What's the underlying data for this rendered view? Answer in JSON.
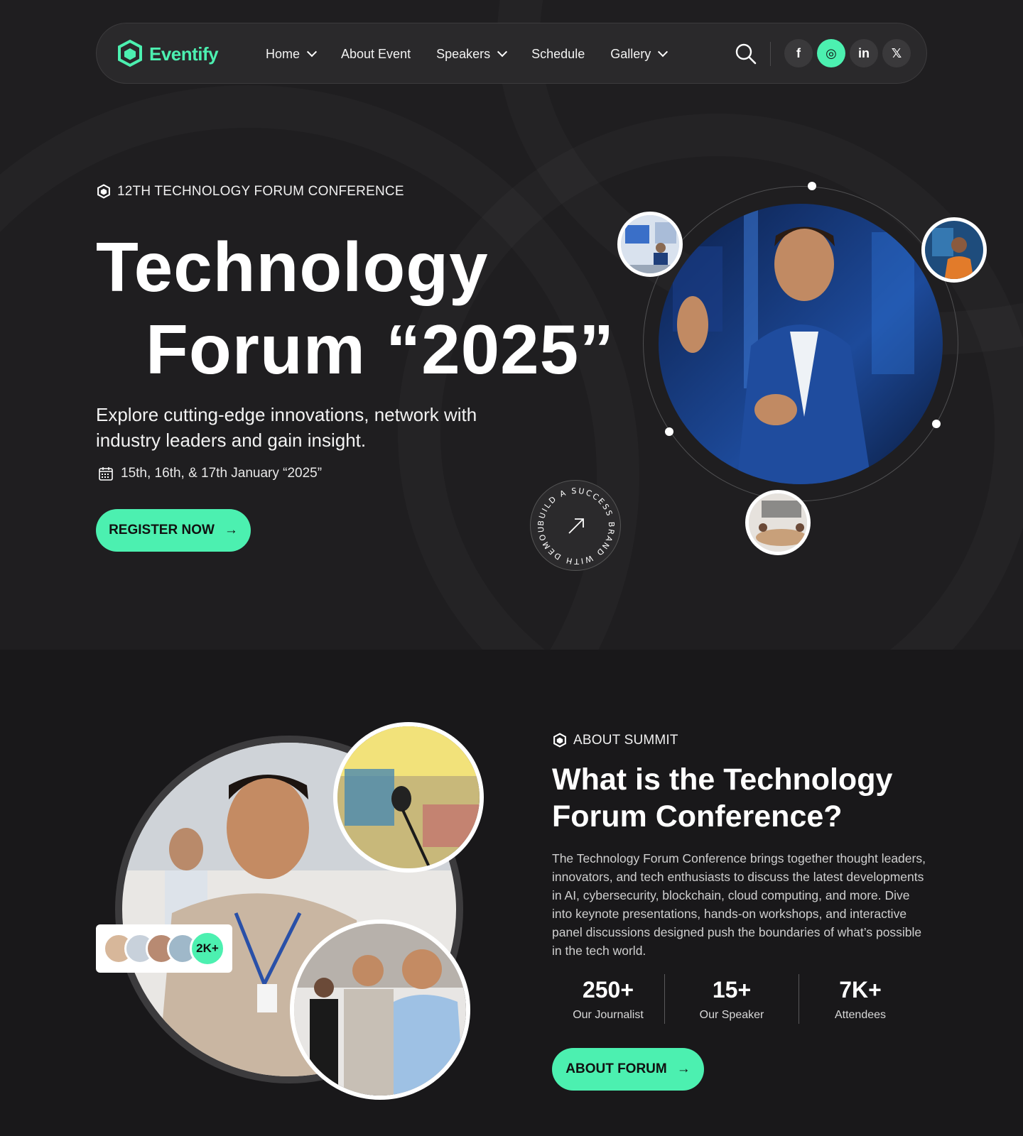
{
  "nav": {
    "brand": "Eventify",
    "items": [
      {
        "label": "Home",
        "dropdown": true
      },
      {
        "label": "About Event",
        "dropdown": false
      },
      {
        "label": "Speakers",
        "dropdown": true
      },
      {
        "label": "Schedule",
        "dropdown": false
      },
      {
        "label": "Gallery",
        "dropdown": true
      }
    ],
    "socials": [
      {
        "label": "f",
        "icon": "facebook-icon"
      },
      {
        "label": "◎",
        "icon": "instagram-icon",
        "active": true
      },
      {
        "label": "in",
        "icon": "linkedin-icon"
      },
      {
        "label": "𝕏",
        "icon": "x-icon"
      }
    ]
  },
  "hero": {
    "eyebrow": "12TH TECHNOLOGY FORUM CONFERENCE",
    "title_line1": "Technology",
    "title_line2": "Forum “2025”",
    "subtitle": "Explore cutting-edge innovations, network with industry leaders and gain insight.",
    "date": "15th, 16th, & 17th January “2025”",
    "cta": "REGISTER NOW",
    "badge_text": "BUILD A SUCCESS BRAND WITH DEMOUI"
  },
  "about": {
    "eyebrow": "ABOUT SUMMIT",
    "title": "What is the Technology Forum Conference?",
    "body": "The Technology Forum Conference brings together thought leaders, innovators, and tech enthusiasts to discuss the latest developments in AI, cybersecurity, blockchain, cloud computing, and more. Dive into keynote presentations, hands-on workshops, and interactive panel discussions designed push the boundaries of what’s possible in the tech world.",
    "attendee_count": "2K+",
    "stats": [
      {
        "value": "250+",
        "label": "Our Journalist"
      },
      {
        "value": "15+",
        "label": "Our Speaker"
      },
      {
        "value": "7K+",
        "label": "Attendees"
      }
    ],
    "cta": "ABOUT FORUM"
  },
  "colors": {
    "accent": "#4cf0b0",
    "background": "#19181a"
  }
}
